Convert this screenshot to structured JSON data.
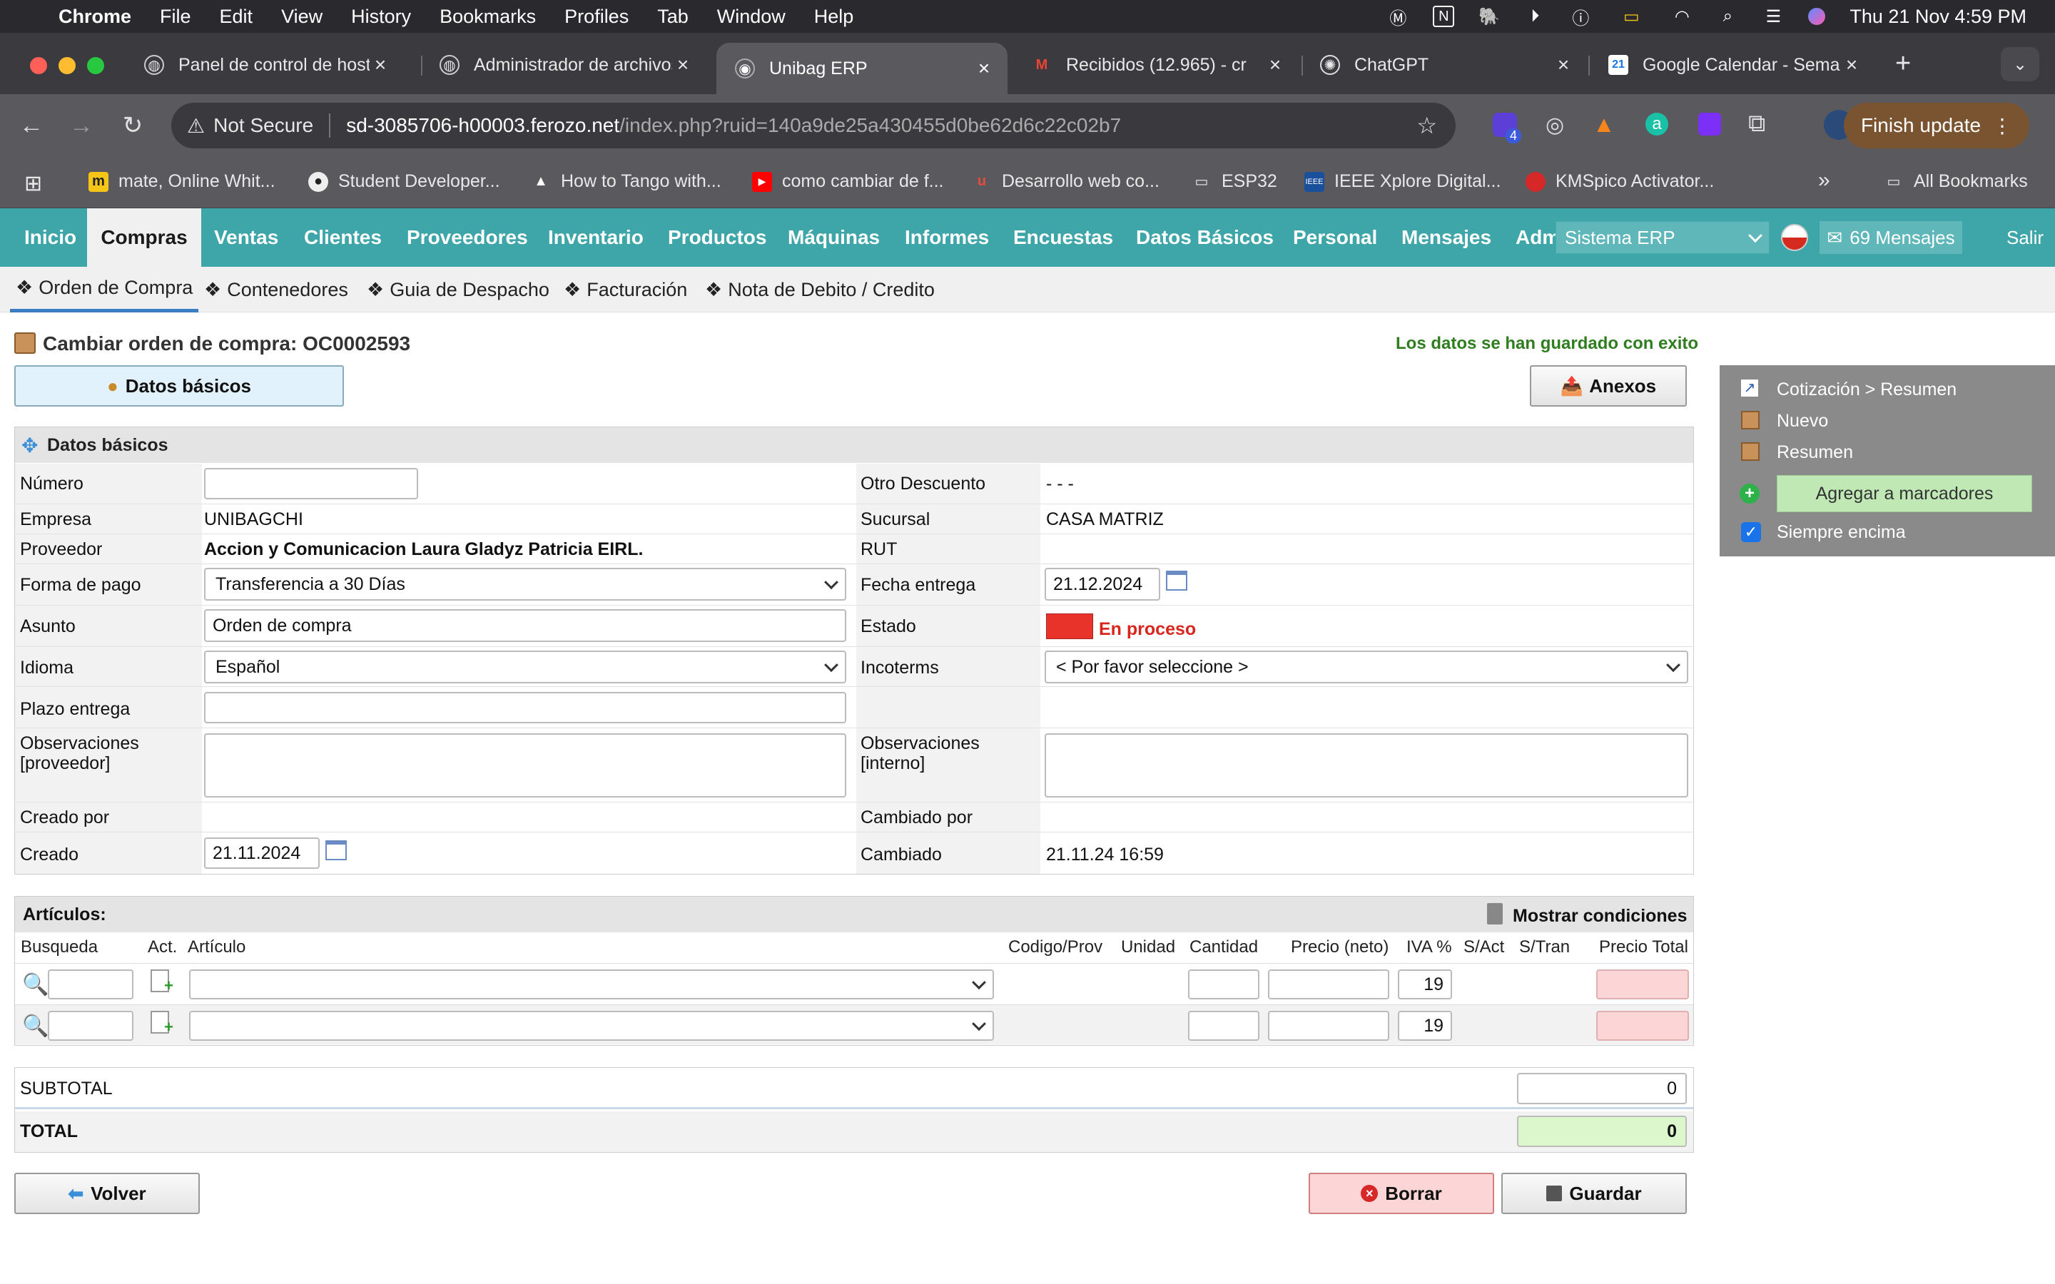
{
  "menubar": {
    "app": "Chrome",
    "items": [
      "File",
      "Edit",
      "View",
      "History",
      "Bookmarks",
      "Profiles",
      "Tab",
      "Window",
      "Help"
    ],
    "clock": "Thu 21 Nov  4:59 PM"
  },
  "tabs": [
    {
      "title": "Panel de control de hosting"
    },
    {
      "title": "Administrador de archivos"
    },
    {
      "title": "Unibag ERP"
    },
    {
      "title": "Recibidos (12.965) - cr"
    },
    {
      "title": "ChatGPT"
    },
    {
      "title": "Google Calendar - Semana"
    }
  ],
  "toolbar": {
    "security": "Not Secure",
    "url_host": "sd-3085706-h00003.ferozo.net",
    "url_path": "/index.php?ruid=140a9de25a430455d0be62d6c22c02b7",
    "finish_update": "Finish update",
    "ext_badge": "4"
  },
  "bookmarks": [
    {
      "label": "mate, Online Whit..."
    },
    {
      "label": "Student Developer..."
    },
    {
      "label": "How to Tango with..."
    },
    {
      "label": "como cambiar de f..."
    },
    {
      "label": "Desarrollo web co..."
    },
    {
      "label": "ESP32"
    },
    {
      "label": "IEEE Xplore Digital..."
    },
    {
      "label": "KMSpico Activator..."
    },
    {
      "label": "All Bookmarks"
    }
  ],
  "nav": {
    "items": [
      "Inicio",
      "Compras",
      "Ventas",
      "Clientes",
      "Proveedores",
      "Inventario",
      "Productos",
      "Máquinas",
      "Informes",
      "Encuestas",
      "Datos Básicos",
      "Personal",
      "Mensajes",
      "Adm"
    ],
    "system": "Sistema ERP",
    "messages": "69 Mensajes",
    "logout": "Salir"
  },
  "subnav": [
    "Orden de Compra",
    "Contenedores",
    "Guia de Despacho",
    "Facturación",
    "Nota de Debito / Credito"
  ],
  "page": {
    "title": "Cambiar orden de compra: OC0002593",
    "success": "Los datos se han guardado con exito",
    "tab_basic": "Datos básicos",
    "annex": "Anexos",
    "section_title": "Datos básicos"
  },
  "form": {
    "numero_label": "Número",
    "numero_value": "",
    "otro_desc_label": "Otro Descuento",
    "otro_desc_value": "- - -",
    "empresa_label": "Empresa",
    "empresa_value": "UNIBAGCHI",
    "sucursal_label": "Sucursal",
    "sucursal_value": "CASA MATRIZ",
    "proveedor_label": "Proveedor",
    "proveedor_value": "Accion y Comunicacion Laura Gladyz Patricia EIRL.",
    "rut_label": "RUT",
    "rut_value": "",
    "forma_pago_label": "Forma de pago",
    "forma_pago_value": "Transferencia a 30 Días",
    "fecha_entrega_label": "Fecha entrega",
    "fecha_entrega_value": "21.12.2024",
    "asunto_label": "Asunto",
    "asunto_value": "Orden de compra",
    "estado_label": "Estado",
    "estado_value": "En proceso",
    "estado_color": "#e8332a",
    "idioma_label": "Idioma",
    "idioma_value": "Español",
    "incoterms_label": "Incoterms",
    "incoterms_value": "< Por favor seleccione >",
    "plazo_label": "Plazo entrega",
    "plazo_value": "",
    "obs_prov_label1": "Observaciones",
    "obs_prov_label2": "[proveedor]",
    "obs_int_label1": "Observaciones",
    "obs_int_label2": "[interno]",
    "creado_por_label": "Creado por",
    "cambiado_por_label": "Cambiado por",
    "creado_label": "Creado",
    "creado_value": "21.11.2024",
    "cambiado_label": "Cambiado",
    "cambiado_value": "21.11.24 16:59"
  },
  "articles": {
    "title": "Artículos:",
    "show_conditions": "Mostrar condiciones",
    "columns": [
      "Busqueda",
      "Act.",
      "Artículo",
      "Codigo/Prov",
      "Unidad",
      "Cantidad",
      "Precio (neto)",
      "IVA %",
      "S/Act",
      "S/Tran",
      "Precio Total"
    ],
    "rows": [
      {
        "iva": "19"
      },
      {
        "iva": "19"
      }
    ]
  },
  "totals": {
    "subtotal_label": "SUBTOTAL",
    "subtotal_value": "0",
    "total_label": "TOTAL",
    "total_value": "0"
  },
  "actions": {
    "back": "Volver",
    "delete": "Borrar",
    "save": "Guardar"
  },
  "sidepanel": {
    "items": [
      "Cotización > Resumen",
      "Nuevo",
      "Resumen"
    ],
    "add_bookmark": "Agregar a marcadores",
    "always_top": "Siempre encima"
  }
}
